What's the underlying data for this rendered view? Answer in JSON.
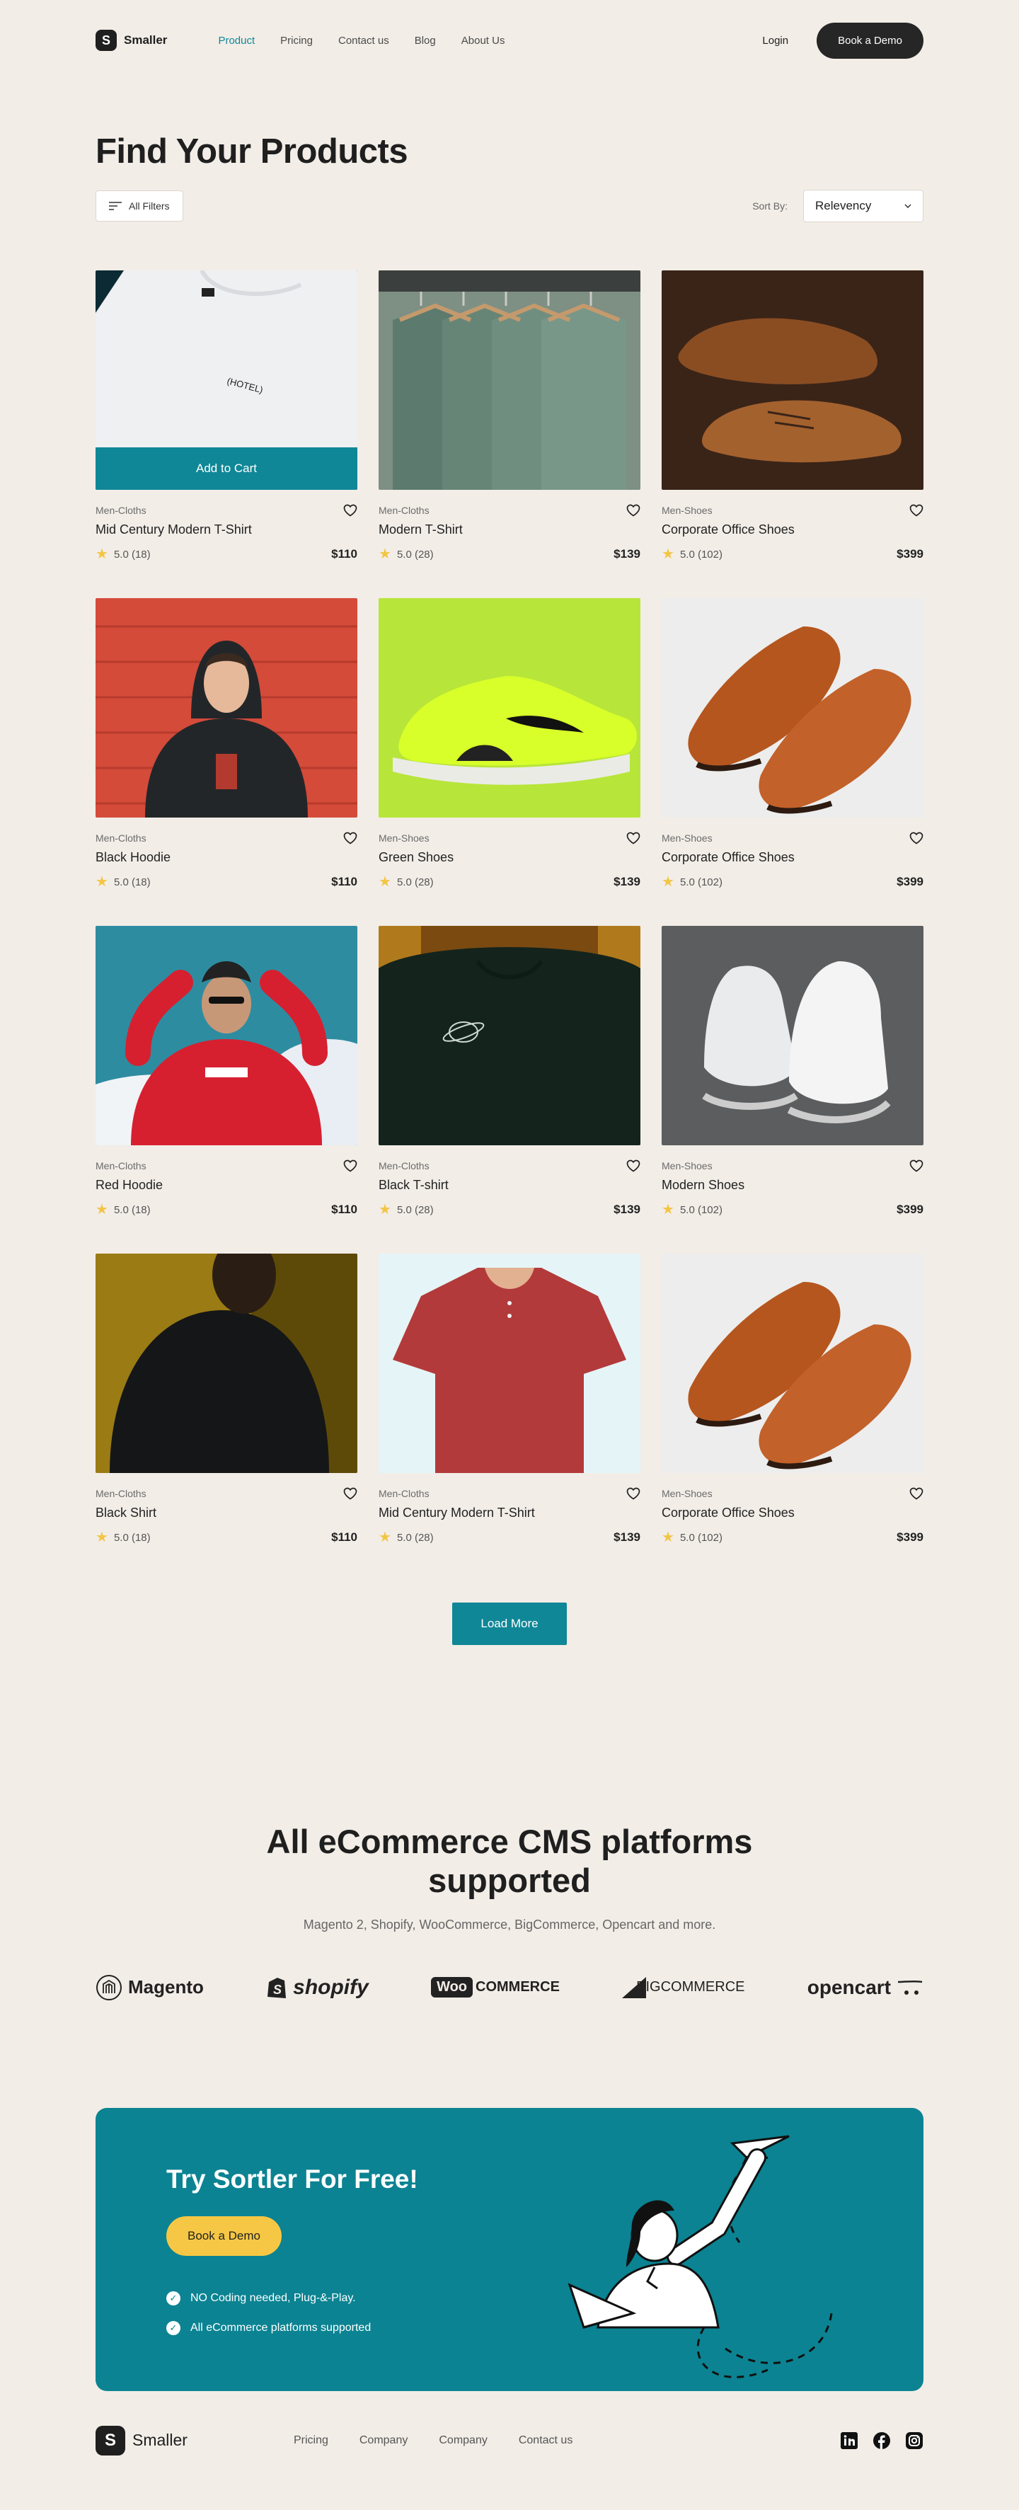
{
  "nav": {
    "brand": "Smaller",
    "logo_letter": "S",
    "links": [
      "Product",
      "Pricing",
      "Contact us",
      "Blog",
      "About Us"
    ],
    "login": "Login",
    "cta": "Book a Demo"
  },
  "header": {
    "title": "Find Your Products",
    "filters_label": "All Filters",
    "sort_label": "Sort By:",
    "sort_value": "Relevency"
  },
  "products": [
    {
      "category": "Men-Cloths",
      "name": "Mid Century Modern T-Shirt",
      "rating": "5.0 (18)",
      "price": "$110",
      "hover_label": "Add to Cart",
      "image": "white-tshirt-icon"
    },
    {
      "category": "Men-Cloths",
      "name": "Modern T-Shirt",
      "rating": "5.0 (28)",
      "price": "$139",
      "image": "hanging-shirts-icon"
    },
    {
      "category": "Men-Shoes",
      "name": "Corporate Office Shoes",
      "rating": "5.0 (102)",
      "price": "$399",
      "image": "brown-oxford-shoes-icon"
    },
    {
      "category": "Men-Cloths",
      "name": "Black Hoodie",
      "rating": "5.0 (18)",
      "price": "$110",
      "image": "black-hoodie-icon"
    },
    {
      "category": "Men-Shoes",
      "name": "Green Shoes",
      "rating": "5.0 (28)",
      "price": "$139",
      "image": "green-sneaker-icon"
    },
    {
      "category": "Men-Shoes",
      "name": "Corporate Office Shoes",
      "rating": "5.0 (102)",
      "price": "$399",
      "image": "brown-loafers-icon"
    },
    {
      "category": "Men-Cloths",
      "name": "Red Hoodie",
      "rating": "5.0 (18)",
      "price": "$110",
      "image": "red-hoodie-icon"
    },
    {
      "category": "Men-Cloths",
      "name": "Black T-shirt",
      "rating": "5.0 (28)",
      "price": "$139",
      "image": "black-tshirt-icon"
    },
    {
      "category": "Men-Shoes",
      "name": "Modern Shoes",
      "rating": "5.0 (102)",
      "price": "$399",
      "image": "white-hightop-icon"
    },
    {
      "category": "Men-Cloths",
      "name": "Black Shirt",
      "rating": "5.0 (18)",
      "price": "$110",
      "image": "black-shirt-icon"
    },
    {
      "category": "Men-Cloths",
      "name": "Mid Century Modern T-Shirt",
      "rating": "5.0 (28)",
      "price": "$139",
      "image": "red-polo-icon"
    },
    {
      "category": "Men-Shoes",
      "name": "Corporate Office Shoes",
      "rating": "5.0 (102)",
      "price": "$399",
      "image": "brown-loafers-icon"
    }
  ],
  "load_more": "Load More",
  "platforms": {
    "title": "All eCommerce CMS platforms supported",
    "subtitle": "Magento 2, Shopify, WooCommerce, BigCommerce, Opencart and more.",
    "logos": [
      "Magento",
      "shopify",
      "COMMERCE",
      "BIGCOMMERCE",
      "opencart"
    ]
  },
  "cta": {
    "title": "Try Sortler For Free!",
    "button": "Book a Demo",
    "points": [
      "NO Coding needed, Plug-&-Play.",
      "All eCommerce platforms supported"
    ]
  },
  "footer": {
    "brand": "Smaller",
    "links": [
      "Pricing",
      "Company",
      "Company",
      "Contact us"
    ],
    "socials": [
      "linkedin-icon",
      "facebook-icon",
      "instagram-icon"
    ]
  },
  "colors": {
    "background": "#f2ede7",
    "teal": "#0f8797",
    "yellow": "#f6c744",
    "dark": "#262626"
  }
}
